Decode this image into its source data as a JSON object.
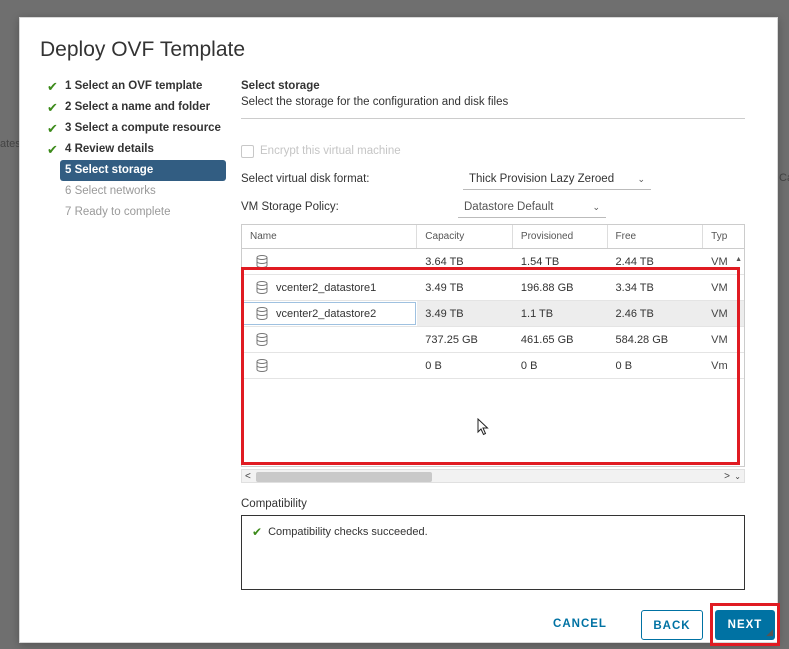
{
  "background": {
    "left_text": "ates",
    "right_text": "Ca"
  },
  "dialog": {
    "title": "Deploy OVF Template"
  },
  "steps": [
    {
      "label": "1 Select an OVF template",
      "state": "done"
    },
    {
      "label": "2 Select a name and folder",
      "state": "done"
    },
    {
      "label": "3 Select a compute resource",
      "state": "done"
    },
    {
      "label": "4 Review details",
      "state": "done"
    },
    {
      "label": "5 Select storage",
      "state": "active"
    },
    {
      "label": "6 Select networks",
      "state": "pending"
    },
    {
      "label": "7 Ready to complete",
      "state": "pending"
    }
  ],
  "content": {
    "title": "Select storage",
    "subtitle": "Select the storage for the configuration and disk files",
    "encrypt_label": "Encrypt this virtual machine",
    "disk_format_label": "Select virtual disk format:",
    "disk_format_value": "Thick Provision Lazy Zeroed",
    "policy_label": "VM Storage Policy:",
    "policy_value": "Datastore Default"
  },
  "grid": {
    "headers": {
      "name": "Name",
      "capacity": "Capacity",
      "provisioned": "Provisioned",
      "free": "Free",
      "type": "Typ"
    },
    "rows": [
      {
        "name": "",
        "capacity": "3.64 TB",
        "provisioned": "1.54 TB",
        "free": "2.44 TB",
        "type": "VM"
      },
      {
        "name": "vcenter2_datastore1",
        "capacity": "3.49 TB",
        "provisioned": "196.88 GB",
        "free": "3.34 TB",
        "type": "VM"
      },
      {
        "name": "vcenter2_datastore2",
        "capacity": "3.49 TB",
        "provisioned": "1.1 TB",
        "free": "2.46 TB",
        "type": "VM"
      },
      {
        "name": "",
        "capacity": "737.25 GB",
        "provisioned": "461.65 GB",
        "free": "584.28 GB",
        "type": "VM"
      },
      {
        "name": "",
        "capacity": "0 B",
        "provisioned": "0 B",
        "free": "0 B",
        "type": "Vm"
      }
    ]
  },
  "compatibility": {
    "label": "Compatibility",
    "message": "Compatibility checks succeeded."
  },
  "buttons": {
    "cancel": "CANCEL",
    "back": "BACK",
    "next": "NEXT"
  },
  "colors": {
    "accent": "#0072a3",
    "active_step": "#325d82",
    "highlight": "#e01b22",
    "success": "#3c8a1a"
  },
  "icons": {
    "step_done": "check-icon",
    "datastore": "database-icon",
    "compat": "check-icon"
  }
}
